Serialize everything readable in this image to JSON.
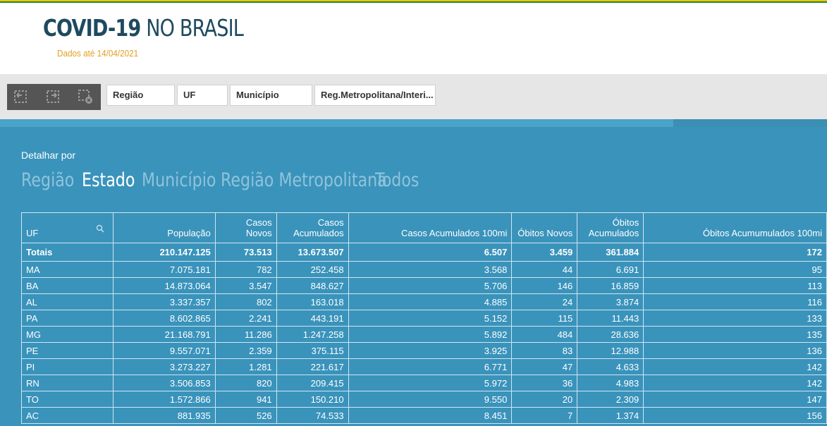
{
  "header": {
    "title_bold": "COVID-19",
    "title_light": "NO BRASIL",
    "subtitle": "Dados até 14/04/2021"
  },
  "toolbar": {
    "selection_tools": [
      "back-selection-icon",
      "forward-selection-icon",
      "clear-selection-icon"
    ],
    "filters": [
      "Região",
      "UF",
      "Município",
      "Reg.Metropolitana/Interi..."
    ]
  },
  "main": {
    "detalhar_label": "Detalhar por",
    "tabs": [
      "Região",
      "Estado",
      "Município",
      "Região Metropolitana",
      "Todos"
    ],
    "active_tab": "Estado"
  },
  "table": {
    "headers": [
      "UF",
      "População",
      "Casos Novos",
      "Casos Acumulados",
      "Casos Acumulados 100mi",
      "Óbitos Novos",
      "Óbitos Acumulados",
      "Óbitos Acumumulados 100mi"
    ],
    "totals": [
      "Totais",
      "210.147.125",
      "73.513",
      "13.673.507",
      "6.507",
      "3.459",
      "361.884",
      "172"
    ],
    "rows": [
      [
        "MA",
        "7.075.181",
        "782",
        "252.458",
        "3.568",
        "44",
        "6.691",
        "95"
      ],
      [
        "BA",
        "14.873.064",
        "3.547",
        "848.627",
        "5.706",
        "146",
        "16.859",
        "113"
      ],
      [
        "AL",
        "3.337.357",
        "802",
        "163.018",
        "4.885",
        "24",
        "3.874",
        "116"
      ],
      [
        "PA",
        "8.602.865",
        "2.241",
        "443.191",
        "5.152",
        "115",
        "11.443",
        "133"
      ],
      [
        "MG",
        "21.168.791",
        "11.286",
        "1.247.258",
        "5.892",
        "484",
        "28.636",
        "135"
      ],
      [
        "PE",
        "9.557.071",
        "2.359",
        "375.115",
        "3.925",
        "83",
        "12.988",
        "136"
      ],
      [
        "PI",
        "3.273.227",
        "1.281",
        "221.617",
        "6.771",
        "47",
        "4.633",
        "142"
      ],
      [
        "RN",
        "3.506.853",
        "820",
        "209.415",
        "5.972",
        "36",
        "4.983",
        "142"
      ],
      [
        "TO",
        "1.572.866",
        "941",
        "150.210",
        "9.550",
        "20",
        "2.309",
        "147"
      ],
      [
        "AC",
        "881.935",
        "526",
        "74.533",
        "8.451",
        "7",
        "1.374",
        "156"
      ]
    ]
  }
}
